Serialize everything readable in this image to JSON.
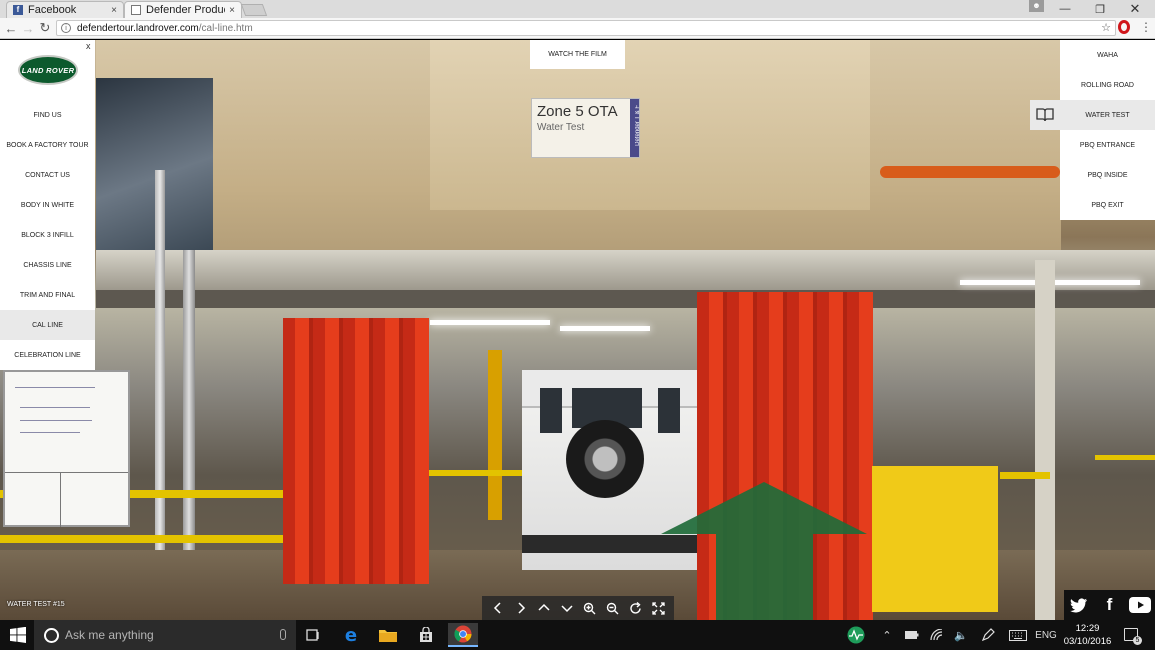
{
  "browser": {
    "tabs": [
      {
        "title": "Facebook",
        "favicon": "facebook-icon"
      },
      {
        "title": "Defender Productio",
        "favicon": "page-icon"
      }
    ],
    "tab_close": "×",
    "url_domain": "defendertour.landrover.com",
    "url_path": "/cal-line.htm"
  },
  "left_nav": {
    "logo_text": "LAND ROVER",
    "close": "x",
    "items": [
      {
        "label": "FIND US"
      },
      {
        "label": "BOOK A FACTORY TOUR"
      },
      {
        "label": "CONTACT US"
      },
      {
        "label": "BODY IN WHITE"
      },
      {
        "label": "BLOCK 3 INFILL"
      },
      {
        "label": "CHASSIS LINE"
      },
      {
        "label": "TRIM AND FINAL"
      },
      {
        "label": "CAL LINE",
        "active": true
      },
      {
        "label": "CELEBRATION LINE"
      }
    ]
  },
  "watch_film": {
    "label": "WATCH THE FILM"
  },
  "right_nav": {
    "items": [
      {
        "label": "WAHA"
      },
      {
        "label": "ROLLING ROAD"
      },
      {
        "label": "WATER TEST",
        "active": true
      },
      {
        "label": "PBQ ENTRANCE"
      },
      {
        "label": "PBQ INSIDE"
      },
      {
        "label": "PBQ EXIT"
      }
    ]
  },
  "scene": {
    "sign_title": "Zone 5 OTA",
    "sign_subtitle": "Water Test",
    "sign_tag": "Defender T & F",
    "label": "WATER TEST #15"
  },
  "viewer_controls": [
    "chevron-left-icon",
    "chevron-right-icon",
    "chevron-up-icon",
    "chevron-down-icon",
    "zoom-in-icon",
    "zoom-out-icon",
    "rotate-icon",
    "fullscreen-icon"
  ],
  "social": [
    "twitter-icon",
    "facebook-icon",
    "youtube-icon"
  ],
  "taskbar": {
    "search_placeholder": "Ask me anything",
    "language": "ENG",
    "time": "12:29",
    "date": "03/10/2016",
    "notifications": "5"
  },
  "colors": {
    "landrover_green": "#0c5a2d",
    "arrow_green": "#1f6b3a",
    "curtain_red": "#d8351a",
    "rail_yellow": "#e3c300"
  }
}
